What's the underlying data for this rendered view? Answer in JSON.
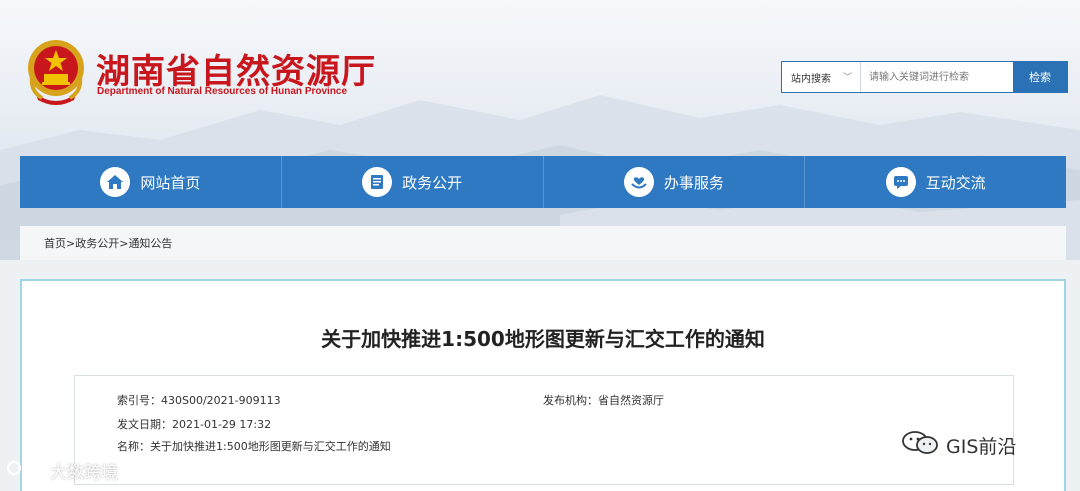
{
  "header": {
    "title": "湖南省自然资源厅",
    "subtitle": "Department of Natural Resources of Hunan Province"
  },
  "search": {
    "scope": "站内搜索",
    "placeholder": "请输入关键词进行检索",
    "button": "检索"
  },
  "nav": {
    "items": [
      {
        "label": "网站首页",
        "icon": "home-icon"
      },
      {
        "label": "政务公开",
        "icon": "document-icon"
      },
      {
        "label": "办事服务",
        "icon": "hands-heart-icon"
      },
      {
        "label": "互动交流",
        "icon": "chat-icon"
      }
    ]
  },
  "breadcrumb": [
    "首页",
    ">",
    "政务公开",
    ">",
    "通知公告"
  ],
  "article": {
    "title": "关于加快推进1:500地形图更新与汇交工作的通知",
    "index_label": "索引号：",
    "index_value": "430S00/2021-909113",
    "publisher_label": "发布机构：",
    "publisher_value": "省自然资源厅",
    "date_label": "发文日期：",
    "date_value": "2021-01-29 17:32",
    "name_label": "名称：",
    "name_value": "关于加快推进1:500地形图更新与汇交工作的通知"
  },
  "watermarks": {
    "left": "大数跨境",
    "right": "GIS前沿"
  },
  "colors": {
    "brand_red": "#c8161d",
    "nav_blue": "#2e79c1",
    "panel_border": "#9fd6e6"
  }
}
